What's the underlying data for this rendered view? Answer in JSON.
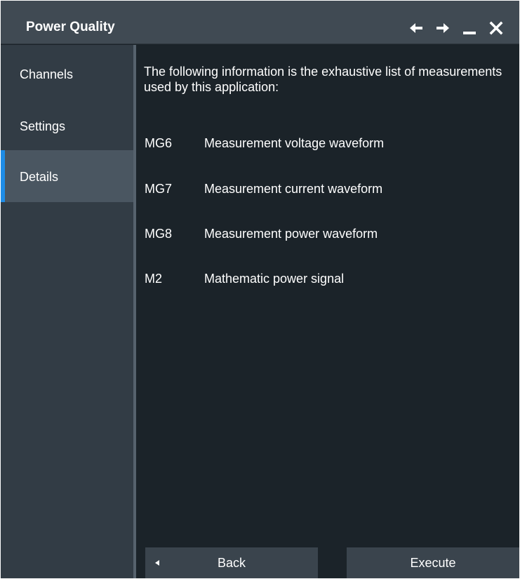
{
  "window": {
    "title": "Power Quality"
  },
  "titlebar_icons": [
    "arrow-left-icon",
    "arrow-right-icon",
    "minimize-icon",
    "close-icon"
  ],
  "sidebar": {
    "items": [
      {
        "label": "Channels",
        "active": false
      },
      {
        "label": "Settings",
        "active": false
      },
      {
        "label": "Details",
        "active": true
      }
    ]
  },
  "details": {
    "intro": "The following information is the exhaustive list of measurements used by this application:",
    "measurements": [
      {
        "code": "MG6",
        "description": "Measurement voltage waveform"
      },
      {
        "code": "MG7",
        "description": "Measurement current waveform"
      },
      {
        "code": "MG8",
        "description": "Measurement power waveform"
      },
      {
        "code": "M2",
        "description": "Mathematic power signal"
      }
    ]
  },
  "footer": {
    "back_label": "Back",
    "execute_label": "Execute"
  },
  "colors": {
    "accent": "#1e8ce6",
    "background": "#1b2329",
    "sidebar": "#323c45",
    "titlebar": "#404a53"
  }
}
